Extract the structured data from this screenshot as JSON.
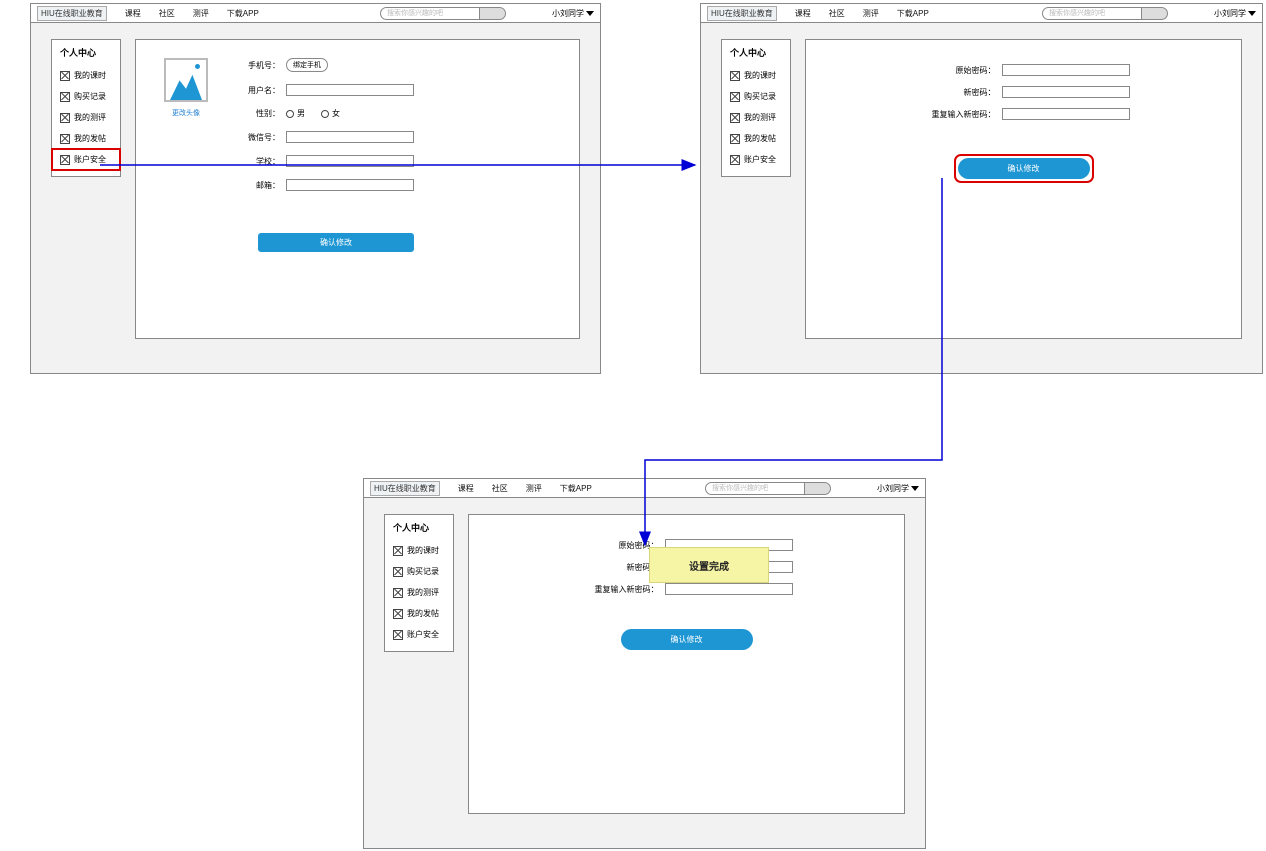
{
  "header": {
    "logo": "HIU在线职业教育",
    "nav": [
      "课程",
      "社区",
      "测评",
      "下载APP"
    ],
    "search_placeholder": "搜索你感兴趣的吧",
    "user_label": "小刘同学"
  },
  "sidebar": {
    "title": "个人中心",
    "items": [
      "我的课时",
      "购买记录",
      "我的测评",
      "我的发帖",
      "账户安全"
    ]
  },
  "profile": {
    "avatar_link": "更改头像",
    "labels": {
      "phone": "手机号：",
      "username": "用户名：",
      "gender": "性别：",
      "wechat": "微信号：",
      "school": "学校：",
      "email": "邮箱："
    },
    "bind_phone_btn": "绑定手机",
    "gender_options": {
      "male": "男",
      "female": "女"
    },
    "confirm": "确认修改"
  },
  "password": {
    "labels": {
      "old": "原始密码：",
      "new": "新密码：",
      "repeat": "重复输入新密码："
    },
    "confirm": "确认修改"
  },
  "toast": "设置完成"
}
